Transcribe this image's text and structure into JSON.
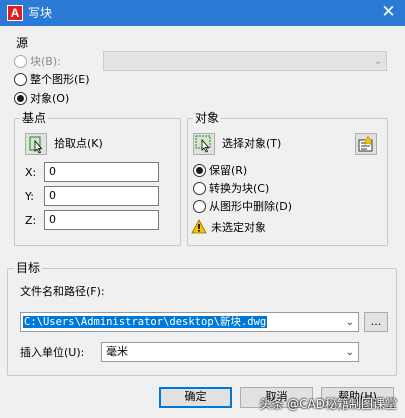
{
  "window": {
    "title": "写块",
    "app_icon_letter": "A",
    "close_glyph": "✕"
  },
  "source": {
    "title": "源",
    "block_label": "块(B):",
    "block_combo_value": "",
    "entire_drawing_label": "整个图形(E)",
    "objects_label": "对象(O)",
    "selected": "objects"
  },
  "base_point": {
    "title": "基点",
    "pick_point_label": "拾取点(K)",
    "x_label": "X:",
    "x_value": "0",
    "y_label": "Y:",
    "y_value": "0",
    "z_label": "Z:",
    "z_value": "0"
  },
  "objects": {
    "title": "对象",
    "select_objects_label": "选择对象(T)",
    "retain_label": "保留(R)",
    "convert_label": "转换为块(C)",
    "delete_label": "从图形中删除(D)",
    "selected": "retain",
    "warning_text": "未选定对象"
  },
  "destination": {
    "title": "目标",
    "filename_label": "文件名和路径(F):",
    "filename_value": "C:\\Users\\Administrator\\desktop\\新块.dwg",
    "browse_label": "...",
    "units_label": "插入单位(U):",
    "units_value": "毫米"
  },
  "buttons": {
    "ok": "确定",
    "cancel": "取消",
    "help": "帮助(H)"
  },
  "watermark": "头条 @CAD秘籍制图课堂",
  "colors": {
    "titlebar": "#2b7bd6",
    "selection": "#0078d7",
    "warning": "#f5c400"
  }
}
